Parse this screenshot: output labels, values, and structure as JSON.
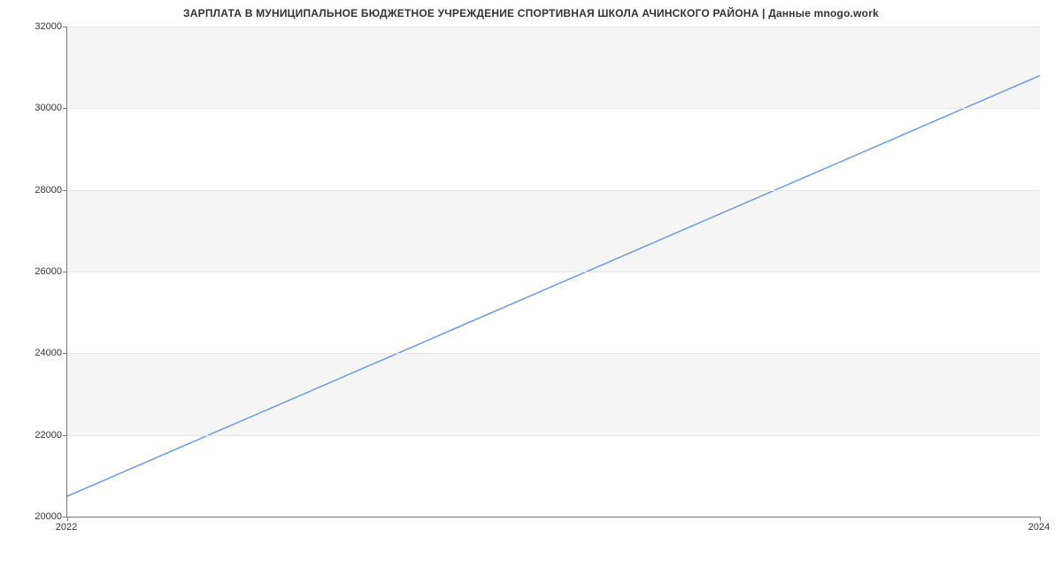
{
  "chart_data": {
    "type": "line",
    "title": "ЗАРПЛАТА В МУНИЦИПАЛЬНОЕ БЮДЖЕТНОЕ УЧРЕЖДЕНИЕ СПОРТИВНАЯ ШКОЛА АЧИНСКОГО РАЙОНА | Данные mnogo.work",
    "x": [
      2022,
      2024
    ],
    "values": [
      20500,
      30800
    ],
    "xlabel": "",
    "ylabel": "",
    "xlim": [
      2022,
      2024
    ],
    "ylim": [
      20000,
      32000
    ],
    "yticks": [
      20000,
      22000,
      24000,
      26000,
      28000,
      30000,
      32000
    ],
    "xticks": [
      2022,
      2024
    ],
    "line_color": "#6b99e5",
    "band_color": "#f5f5f5"
  }
}
